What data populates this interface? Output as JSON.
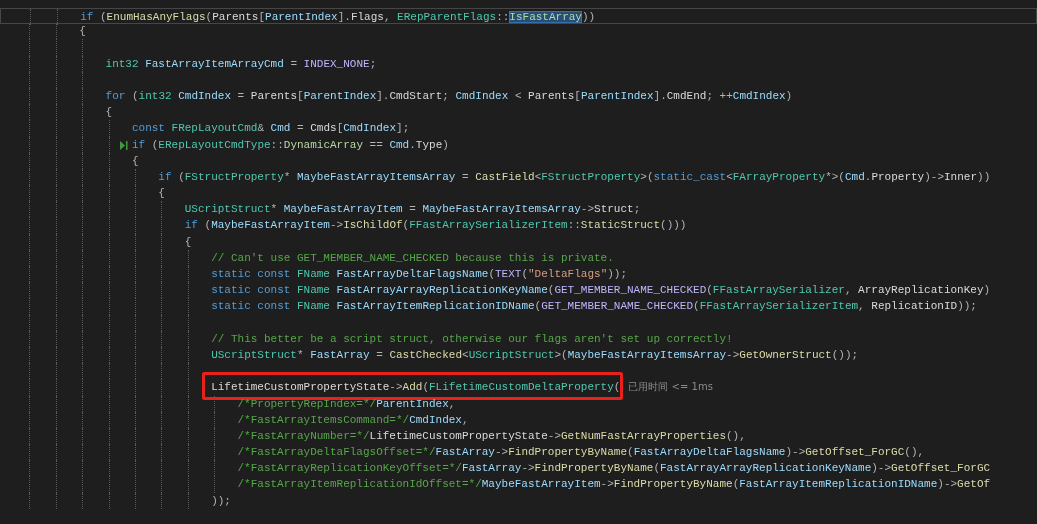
{
  "editor": {
    "lines": [
      {
        "current": true,
        "marker": false,
        "annotated": false,
        "tokens": [
          {
            "kind": "keyword",
            "text": "            if"
          },
          {
            "kind": "punctuation",
            "text": " ("
          },
          {
            "kind": "function",
            "text": "EnumHasAnyFlags"
          },
          {
            "kind": "punctuation",
            "text": "("
          },
          {
            "kind": "member",
            "text": "Parents"
          },
          {
            "kind": "punctuation",
            "text": "["
          },
          {
            "kind": "variable",
            "text": "ParentIndex"
          },
          {
            "kind": "punctuation",
            "text": "]."
          },
          {
            "kind": "member",
            "text": "Flags"
          },
          {
            "kind": "punctuation",
            "text": ", "
          },
          {
            "kind": "type",
            "text": "ERepParentFlags"
          },
          {
            "kind": "punctuation",
            "text": "::"
          },
          {
            "kind": "highlight",
            "text": "IsFastArray"
          },
          {
            "kind": "punctuation",
            "text": "))"
          }
        ]
      },
      {
        "current": false,
        "marker": false,
        "annotated": false,
        "tokens": [
          {
            "kind": "punctuation",
            "text": "            {"
          }
        ]
      },
      {
        "kind": "blank"
      },
      {
        "current": false,
        "marker": false,
        "annotated": false,
        "tokens": [
          {
            "kind": "type",
            "text": "                int32 "
          },
          {
            "kind": "variable",
            "text": "FastArrayItemArrayCmd"
          },
          {
            "kind": "punctuation",
            "text": " = "
          },
          {
            "kind": "macro",
            "text": "INDEX_NONE"
          },
          {
            "kind": "punctuation",
            "text": ";"
          }
        ]
      },
      {
        "kind": "blank"
      },
      {
        "current": false,
        "marker": false,
        "annotated": false,
        "tokens": [
          {
            "kind": "keyword",
            "text": "                for"
          },
          {
            "kind": "punctuation",
            "text": " ("
          },
          {
            "kind": "type",
            "text": "int32 "
          },
          {
            "kind": "variable",
            "text": "CmdIndex"
          },
          {
            "kind": "punctuation",
            "text": " = "
          },
          {
            "kind": "member",
            "text": "Parents"
          },
          {
            "kind": "punctuation",
            "text": "["
          },
          {
            "kind": "variable",
            "text": "ParentIndex"
          },
          {
            "kind": "punctuation",
            "text": "]."
          },
          {
            "kind": "member",
            "text": "CmdStart"
          },
          {
            "kind": "punctuation",
            "text": "; "
          },
          {
            "kind": "variable",
            "text": "CmdIndex"
          },
          {
            "kind": "punctuation",
            "text": " < "
          },
          {
            "kind": "member",
            "text": "Parents"
          },
          {
            "kind": "punctuation",
            "text": "["
          },
          {
            "kind": "variable",
            "text": "ParentIndex"
          },
          {
            "kind": "punctuation",
            "text": "]."
          },
          {
            "kind": "member",
            "text": "CmdEnd"
          },
          {
            "kind": "punctuation",
            "text": "; ++"
          },
          {
            "kind": "variable",
            "text": "CmdIndex"
          },
          {
            "kind": "punctuation",
            "text": ")"
          }
        ]
      },
      {
        "current": false,
        "marker": false,
        "annotated": false,
        "tokens": [
          {
            "kind": "punctuation",
            "text": "                {"
          }
        ]
      },
      {
        "current": false,
        "marker": false,
        "annotated": false,
        "tokens": [
          {
            "kind": "keyword",
            "text": "                    const "
          },
          {
            "kind": "type",
            "text": "FRepLayoutCmd"
          },
          {
            "kind": "punctuation",
            "text": "& "
          },
          {
            "kind": "variable",
            "text": "Cmd"
          },
          {
            "kind": "punctuation",
            "text": " = "
          },
          {
            "kind": "member",
            "text": "Cmds"
          },
          {
            "kind": "punctuation",
            "text": "["
          },
          {
            "kind": "variable",
            "text": "CmdIndex"
          },
          {
            "kind": "punctuation",
            "text": "];"
          }
        ]
      },
      {
        "current": false,
        "marker": true,
        "annotated": false,
        "tokens": [
          {
            "kind": "keyword",
            "text": "                    if"
          },
          {
            "kind": "punctuation",
            "text": " ("
          },
          {
            "kind": "type",
            "text": "ERepLayoutCmdType"
          },
          {
            "kind": "punctuation",
            "text": "::"
          },
          {
            "kind": "enum",
            "text": "DynamicArray"
          },
          {
            "kind": "punctuation",
            "text": " == "
          },
          {
            "kind": "variable",
            "text": "Cmd"
          },
          {
            "kind": "punctuation",
            "text": "."
          },
          {
            "kind": "member",
            "text": "Type"
          },
          {
            "kind": "punctuation",
            "text": ")"
          }
        ]
      },
      {
        "current": false,
        "marker": false,
        "annotated": false,
        "tokens": [
          {
            "kind": "punctuation",
            "text": "                    {"
          }
        ]
      },
      {
        "current": false,
        "marker": false,
        "annotated": false,
        "tokens": [
          {
            "kind": "keyword",
            "text": "                        if"
          },
          {
            "kind": "punctuation",
            "text": " ("
          },
          {
            "kind": "type",
            "text": "FStructProperty"
          },
          {
            "kind": "punctuation",
            "text": "* "
          },
          {
            "kind": "variable",
            "text": "MaybeFastArrayItemsArray"
          },
          {
            "kind": "punctuation",
            "text": " = "
          },
          {
            "kind": "function",
            "text": "CastField"
          },
          {
            "kind": "punctuation",
            "text": "<"
          },
          {
            "kind": "type",
            "text": "FStructProperty"
          },
          {
            "kind": "punctuation",
            "text": ">("
          },
          {
            "kind": "keyword",
            "text": "static_cast"
          },
          {
            "kind": "punctuation",
            "text": "<"
          },
          {
            "kind": "type",
            "text": "FArrayProperty"
          },
          {
            "kind": "punctuation",
            "text": "*>("
          },
          {
            "kind": "variable",
            "text": "Cmd"
          },
          {
            "kind": "punctuation",
            "text": "."
          },
          {
            "kind": "member",
            "text": "Property"
          },
          {
            "kind": "punctuation",
            "text": ")->"
          },
          {
            "kind": "member",
            "text": "Inner"
          },
          {
            "kind": "punctuation",
            "text": "))"
          }
        ]
      },
      {
        "current": false,
        "marker": false,
        "annotated": false,
        "tokens": [
          {
            "kind": "punctuation",
            "text": "                        {"
          }
        ]
      },
      {
        "current": false,
        "marker": false,
        "annotated": false,
        "tokens": [
          {
            "kind": "type",
            "text": "                            UScriptStruct"
          },
          {
            "kind": "punctuation",
            "text": "* "
          },
          {
            "kind": "variable",
            "text": "MaybeFastArrayItem"
          },
          {
            "kind": "punctuation",
            "text": " = "
          },
          {
            "kind": "variable",
            "text": "MaybeFastArrayItemsArray"
          },
          {
            "kind": "punctuation",
            "text": "->"
          },
          {
            "kind": "member",
            "text": "Struct"
          },
          {
            "kind": "punctuation",
            "text": ";"
          }
        ]
      },
      {
        "current": false,
        "marker": false,
        "annotated": false,
        "tokens": [
          {
            "kind": "keyword",
            "text": "                            if"
          },
          {
            "kind": "punctuation",
            "text": " ("
          },
          {
            "kind": "variable",
            "text": "MaybeFastArrayItem"
          },
          {
            "kind": "punctuation",
            "text": "->"
          },
          {
            "kind": "function",
            "text": "IsChildOf"
          },
          {
            "kind": "punctuation",
            "text": "("
          },
          {
            "kind": "type",
            "text": "FFastArraySerializerItem"
          },
          {
            "kind": "punctuation",
            "text": "::"
          },
          {
            "kind": "function",
            "text": "StaticStruct"
          },
          {
            "kind": "punctuation",
            "text": "()))"
          }
        ]
      },
      {
        "current": false,
        "marker": false,
        "annotated": false,
        "tokens": [
          {
            "kind": "punctuation",
            "text": "                            {"
          }
        ]
      },
      {
        "current": false,
        "marker": false,
        "annotated": false,
        "tokens": [
          {
            "kind": "comment",
            "text": "                                // Can't use GET_MEMBER_NAME_CHECKED because this is private."
          }
        ]
      },
      {
        "current": false,
        "marker": false,
        "annotated": false,
        "tokens": [
          {
            "kind": "keyword",
            "text": "                                static const "
          },
          {
            "kind": "type",
            "text": "FName "
          },
          {
            "kind": "variable",
            "text": "FastArrayDeltaFlagsName"
          },
          {
            "kind": "punctuation",
            "text": "("
          },
          {
            "kind": "macro",
            "text": "TEXT"
          },
          {
            "kind": "punctuation",
            "text": "("
          },
          {
            "kind": "string",
            "text": "\"DeltaFlags\""
          },
          {
            "kind": "punctuation",
            "text": "));"
          }
        ]
      },
      {
        "current": false,
        "marker": false,
        "annotated": false,
        "tokens": [
          {
            "kind": "keyword",
            "text": "                                static const "
          },
          {
            "kind": "type",
            "text": "FName "
          },
          {
            "kind": "variable",
            "text": "FastArrayArrayReplicationKeyName"
          },
          {
            "kind": "punctuation",
            "text": "("
          },
          {
            "kind": "macro",
            "text": "GET_MEMBER_NAME_CHECKED"
          },
          {
            "kind": "punctuation",
            "text": "("
          },
          {
            "kind": "type",
            "text": "FFastArraySerializer"
          },
          {
            "kind": "punctuation",
            "text": ", "
          },
          {
            "kind": "member",
            "text": "ArrayReplicationKey"
          },
          {
            "kind": "punctuation",
            "text": ")"
          }
        ]
      },
      {
        "current": false,
        "marker": false,
        "annotated": false,
        "tokens": [
          {
            "kind": "keyword",
            "text": "                                static const "
          },
          {
            "kind": "type",
            "text": "FName "
          },
          {
            "kind": "variable",
            "text": "FastArrayItemReplicationIDName"
          },
          {
            "kind": "punctuation",
            "text": "("
          },
          {
            "kind": "macro",
            "text": "GET_MEMBER_NAME_CHECKED"
          },
          {
            "kind": "punctuation",
            "text": "("
          },
          {
            "kind": "type",
            "text": "FFastArraySerializerItem"
          },
          {
            "kind": "punctuation",
            "text": ", "
          },
          {
            "kind": "member",
            "text": "ReplicationID"
          },
          {
            "kind": "punctuation",
            "text": "));"
          }
        ]
      },
      {
        "kind": "blank"
      },
      {
        "current": false,
        "marker": false,
        "annotated": false,
        "tokens": [
          {
            "kind": "comment",
            "text": "                                // This better be a script struct, otherwise our flags aren't set up correctly!"
          }
        ]
      },
      {
        "current": false,
        "marker": false,
        "annotated": false,
        "tokens": [
          {
            "kind": "type",
            "text": "                                UScriptStruct"
          },
          {
            "kind": "punctuation",
            "text": "* "
          },
          {
            "kind": "variable",
            "text": "FastArray"
          },
          {
            "kind": "punctuation",
            "text": " = "
          },
          {
            "kind": "function",
            "text": "CastChecked"
          },
          {
            "kind": "punctuation",
            "text": "<"
          },
          {
            "kind": "type",
            "text": "UScriptStruct"
          },
          {
            "kind": "punctuation",
            "text": ">("
          },
          {
            "kind": "variable",
            "text": "MaybeFastArrayItemsArray"
          },
          {
            "kind": "punctuation",
            "text": "->"
          },
          {
            "kind": "function",
            "text": "GetOwnerStruct"
          },
          {
            "kind": "punctuation",
            "text": "());"
          }
        ]
      },
      {
        "kind": "blank"
      },
      {
        "current": false,
        "marker": false,
        "annotated": true,
        "hint": "已用时间 <= 1ms",
        "tokens": [
          {
            "kind": "member",
            "text": "                                LifetimeCustomPropertyState"
          },
          {
            "kind": "punctuation",
            "text": "->"
          },
          {
            "kind": "function",
            "text": "Add"
          },
          {
            "kind": "punctuation",
            "text": "("
          },
          {
            "kind": "type",
            "text": "FLifetimeCustomDeltaProperty"
          },
          {
            "kind": "punctuation",
            "text": "("
          }
        ]
      },
      {
        "current": false,
        "marker": false,
        "annotated": false,
        "tokens": [
          {
            "kind": "comment",
            "text": "                                    /*PropertyRepIndex=*/"
          },
          {
            "kind": "variable",
            "text": "ParentIndex"
          },
          {
            "kind": "punctuation",
            "text": ","
          }
        ]
      },
      {
        "current": false,
        "marker": false,
        "annotated": false,
        "tokens": [
          {
            "kind": "comment",
            "text": "                                    /*FastArrayItemsCommand=*/"
          },
          {
            "kind": "variable",
            "text": "CmdIndex"
          },
          {
            "kind": "punctuation",
            "text": ","
          }
        ]
      },
      {
        "current": false,
        "marker": false,
        "annotated": false,
        "tokens": [
          {
            "kind": "comment",
            "text": "                                    /*FastArrayNumber=*/"
          },
          {
            "kind": "member",
            "text": "LifetimeCustomPropertyState"
          },
          {
            "kind": "punctuation",
            "text": "->"
          },
          {
            "kind": "function",
            "text": "GetNumFastArrayProperties"
          },
          {
            "kind": "punctuation",
            "text": "(),"
          }
        ]
      },
      {
        "current": false,
        "marker": false,
        "annotated": false,
        "tokens": [
          {
            "kind": "comment",
            "text": "                                    /*FastArrayDeltaFlagsOffset=*/"
          },
          {
            "kind": "variable",
            "text": "FastArray"
          },
          {
            "kind": "punctuation",
            "text": "->"
          },
          {
            "kind": "function",
            "text": "FindPropertyByName"
          },
          {
            "kind": "punctuation",
            "text": "("
          },
          {
            "kind": "variable",
            "text": "FastArrayDeltaFlagsName"
          },
          {
            "kind": "punctuation",
            "text": ")->"
          },
          {
            "kind": "function",
            "text": "GetOffset_ForGC"
          },
          {
            "kind": "punctuation",
            "text": "(),"
          }
        ]
      },
      {
        "current": false,
        "marker": false,
        "annotated": false,
        "tokens": [
          {
            "kind": "comment",
            "text": "                                    /*FastArrayReplicationKeyOffset=*/"
          },
          {
            "kind": "variable",
            "text": "FastArray"
          },
          {
            "kind": "punctuation",
            "text": "->"
          },
          {
            "kind": "function",
            "text": "FindPropertyByName"
          },
          {
            "kind": "punctuation",
            "text": "("
          },
          {
            "kind": "variable",
            "text": "FastArrayArrayReplicationKeyName"
          },
          {
            "kind": "punctuation",
            "text": ")->"
          },
          {
            "kind": "function",
            "text": "GetOffset_ForGC"
          }
        ]
      },
      {
        "current": false,
        "marker": false,
        "annotated": false,
        "tokens": [
          {
            "kind": "comment",
            "text": "                                    /*FastArrayItemReplicationIdOffset=*/"
          },
          {
            "kind": "variable",
            "text": "MaybeFastArrayItem"
          },
          {
            "kind": "punctuation",
            "text": "->"
          },
          {
            "kind": "function",
            "text": "FindPropertyByName"
          },
          {
            "kind": "punctuation",
            "text": "("
          },
          {
            "kind": "variable",
            "text": "FastArrayItemReplicationIDName"
          },
          {
            "kind": "punctuation",
            "text": ")->"
          },
          {
            "kind": "function",
            "text": "GetOf"
          }
        ]
      },
      {
        "current": false,
        "marker": false,
        "annotated": false,
        "tokens": [
          {
            "kind": "punctuation",
            "text": "                                ));"
          }
        ]
      }
    ]
  }
}
